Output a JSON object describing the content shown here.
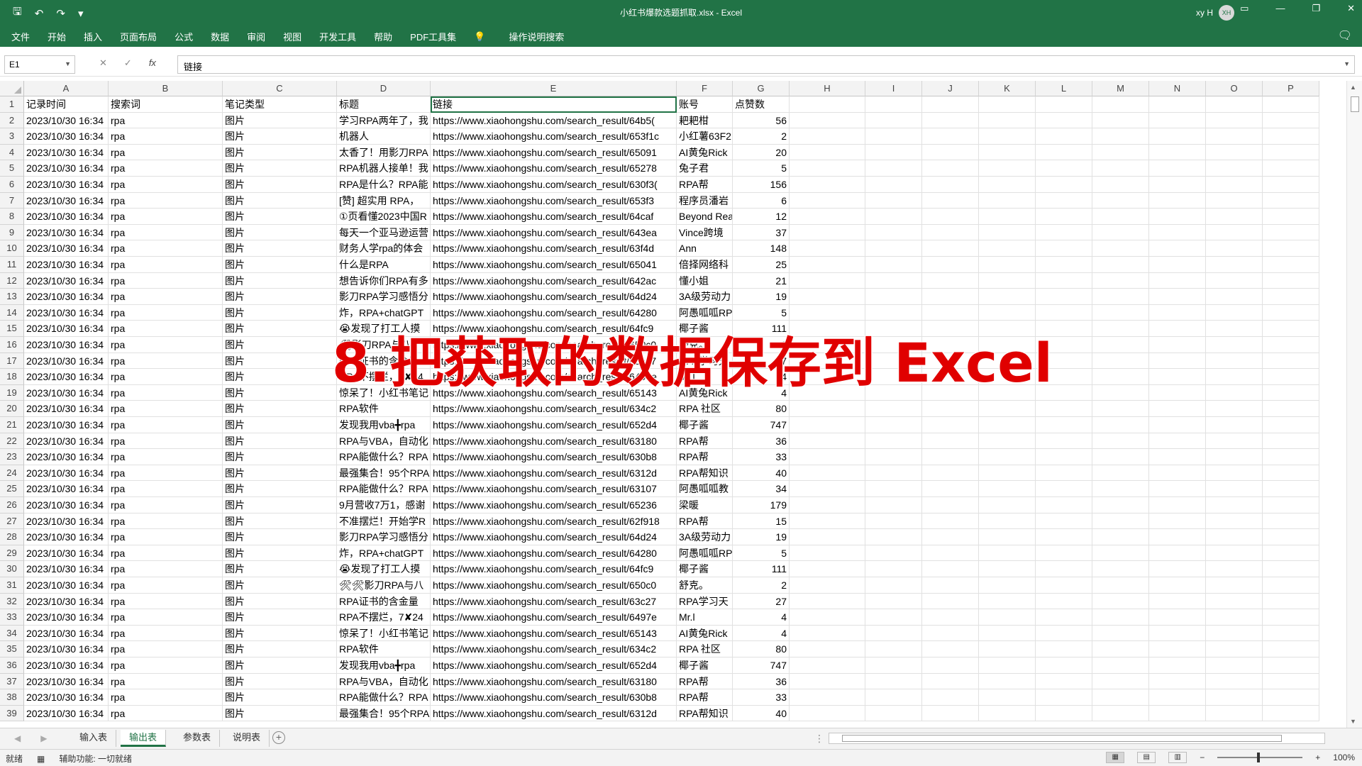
{
  "titlebar": {
    "doc_title": "小红书爆款选题抓取.xlsx  -  Excel",
    "user_name": "xy H",
    "avatar_initials": "XH"
  },
  "menu": [
    "文件",
    "开始",
    "插入",
    "页面布局",
    "公式",
    "数据",
    "审阅",
    "视图",
    "开发工具",
    "帮助",
    "PDF工具集"
  ],
  "tell_me": "操作说明搜索",
  "formula": {
    "name_box": "E1",
    "content": "链接"
  },
  "columns": [
    "A",
    "B",
    "C",
    "D",
    "E",
    "F",
    "G",
    "H",
    "I",
    "J",
    "K",
    "L",
    "M",
    "N",
    "O",
    "P"
  ],
  "header_row": [
    "记录时间",
    "搜索词",
    "笔记类型",
    "标题",
    "链接",
    "账号",
    "点赞数"
  ],
  "rows": [
    [
      "2023/10/30 16:34",
      "rpa",
      "图片",
      "学习RPA两年了，我",
      "https://www.xiaohongshu.com/search_result/64b5(",
      "耙耙柑",
      "56"
    ],
    [
      "2023/10/30 16:34",
      "rpa",
      "图片",
      "机器人",
      "https://www.xiaohongshu.com/search_result/653f1c",
      "小红薯63F2",
      "2"
    ],
    [
      "2023/10/30 16:34",
      "rpa",
      "图片",
      "太香了！用影刀RPA",
      "https://www.xiaohongshu.com/search_result/65091",
      "AI黄兔Rick",
      "20"
    ],
    [
      "2023/10/30 16:34",
      "rpa",
      "图片",
      "RPA机器人接单！我",
      "https://www.xiaohongshu.com/search_result/65278",
      "兔子君",
      "5"
    ],
    [
      "2023/10/30 16:34",
      "rpa",
      "图片",
      "RPA是什么？RPA能",
      "https://www.xiaohongshu.com/search_result/630f3(",
      "RPA帮",
      "156"
    ],
    [
      "2023/10/30 16:34",
      "rpa",
      "图片",
      "[赞] 超实用 RPA，",
      "https://www.xiaohongshu.com/search_result/653f3",
      "程序员潘岩",
      "6"
    ],
    [
      "2023/10/30 16:34",
      "rpa",
      "图片",
      "①页看懂2023中国R",
      "https://www.xiaohongshu.com/search_result/64caf",
      "Beyond Rea",
      "12"
    ],
    [
      "2023/10/30 16:34",
      "rpa",
      "图片",
      "每天一个亚马逊运营",
      "https://www.xiaohongshu.com/search_result/643ea",
      "Vince跨境",
      "37"
    ],
    [
      "2023/10/30 16:34",
      "rpa",
      "图片",
      "财务人学rpa的体会",
      "https://www.xiaohongshu.com/search_result/63f4d",
      "Ann",
      "148"
    ],
    [
      "2023/10/30 16:34",
      "rpa",
      "图片",
      "什么是RPA",
      "https://www.xiaohongshu.com/search_result/65041",
      "倍择网络科",
      "25"
    ],
    [
      "2023/10/30 16:34",
      "rpa",
      "图片",
      "想告诉你们RPA有多",
      "https://www.xiaohongshu.com/search_result/642ac",
      "懂小姐",
      "21"
    ],
    [
      "2023/10/30 16:34",
      "rpa",
      "图片",
      "影刀RPA学习感悟分",
      "https://www.xiaohongshu.com/search_result/64d24",
      "3A级劳动力",
      "19"
    ],
    [
      "2023/10/30 16:34",
      "rpa",
      "图片",
      "炸，RPA+chatGPT",
      "https://www.xiaohongshu.com/search_result/64280",
      "阿愚呱呱RP",
      "5"
    ],
    [
      "2023/10/30 16:34",
      "rpa",
      "图片",
      "😭发现了打工人摸",
      "https://www.xiaohongshu.com/search_result/64fc9",
      "椰子酱",
      "111"
    ],
    [
      "2023/10/30 16:34",
      "rpa",
      "图片",
      "🛠影刀RPA与八",
      "https://www.xiaohongshu.com/search_result/650c0",
      "舒克。",
      "2"
    ],
    [
      "2023/10/30 16:34",
      "rpa",
      "图片",
      "RPA证书的含金量",
      "https://www.xiaohongshu.com/search_result/63c27",
      "RPA学习天",
      "27"
    ],
    [
      "2023/10/30 16:34",
      "rpa",
      "图片",
      "RPA不摆烂，7✘24",
      "https://www.xiaohongshu.com/search_result/6497e",
      "Mr.l",
      "4"
    ],
    [
      "2023/10/30 16:34",
      "rpa",
      "图片",
      "惊呆了！小红书笔记",
      "https://www.xiaohongshu.com/search_result/65143",
      "AI黄兔Rick",
      "4"
    ],
    [
      "2023/10/30 16:34",
      "rpa",
      "图片",
      "RPA软件",
      "https://www.xiaohongshu.com/search_result/634c2",
      "RPA 社区",
      "80"
    ],
    [
      "2023/10/30 16:34",
      "rpa",
      "图片",
      "发现我用vba╋rpa",
      "https://www.xiaohongshu.com/search_result/652d4",
      "椰子酱",
      "747"
    ],
    [
      "2023/10/30 16:34",
      "rpa",
      "图片",
      "RPA与VBA，自动化",
      "https://www.xiaohongshu.com/search_result/63180",
      "RPA帮",
      "36"
    ],
    [
      "2023/10/30 16:34",
      "rpa",
      "图片",
      "RPA能做什么？RPA",
      "https://www.xiaohongshu.com/search_result/630b8",
      "RPA帮",
      "33"
    ],
    [
      "2023/10/30 16:34",
      "rpa",
      "图片",
      "最强集合！95个RPA",
      "https://www.xiaohongshu.com/search_result/6312d",
      "RPA帮知识",
      "40"
    ],
    [
      "2023/10/30 16:34",
      "rpa",
      "图片",
      "RPA能做什么？RPA",
      "https://www.xiaohongshu.com/search_result/63107",
      "阿愚呱呱教",
      "34"
    ],
    [
      "2023/10/30 16:34",
      "rpa",
      "图片",
      "9月营收7万1，感谢",
      "https://www.xiaohongshu.com/search_result/65236",
      "梁暖",
      "179"
    ],
    [
      "2023/10/30 16:34",
      "rpa",
      "图片",
      "不准摆烂！开始学R",
      "https://www.xiaohongshu.com/search_result/62f918",
      "RPA帮",
      "15"
    ],
    [
      "2023/10/30 16:34",
      "rpa",
      "图片",
      "影刀RPA学习感悟分",
      "https://www.xiaohongshu.com/search_result/64d24",
      "3A级劳动力",
      "19"
    ],
    [
      "2023/10/30 16:34",
      "rpa",
      "图片",
      "炸，RPA+chatGPT",
      "https://www.xiaohongshu.com/search_result/64280",
      "阿愚呱呱RP",
      "5"
    ],
    [
      "2023/10/30 16:34",
      "rpa",
      "图片",
      "😭发现了打工人摸",
      "https://www.xiaohongshu.com/search_result/64fc9",
      "椰子酱",
      "111"
    ],
    [
      "2023/10/30 16:34",
      "rpa",
      "图片",
      "🛠🛠影刀RPA与八",
      "https://www.xiaohongshu.com/search_result/650c0",
      "舒克。",
      "2"
    ],
    [
      "2023/10/30 16:34",
      "rpa",
      "图片",
      "RPA证书的含金量",
      "https://www.xiaohongshu.com/search_result/63c27",
      "RPA学习天",
      "27"
    ],
    [
      "2023/10/30 16:34",
      "rpa",
      "图片",
      "RPA不摆烂，7✘24",
      "https://www.xiaohongshu.com/search_result/6497e",
      "Mr.l",
      "4"
    ],
    [
      "2023/10/30 16:34",
      "rpa",
      "图片",
      "惊呆了！小红书笔记",
      "https://www.xiaohongshu.com/search_result/65143",
      "AI黄兔Rick",
      "4"
    ],
    [
      "2023/10/30 16:34",
      "rpa",
      "图片",
      "RPA软件",
      "https://www.xiaohongshu.com/search_result/634c2",
      "RPA 社区",
      "80"
    ],
    [
      "2023/10/30 16:34",
      "rpa",
      "图片",
      "发现我用vba╋rpa",
      "https://www.xiaohongshu.com/search_result/652d4",
      "椰子酱",
      "747"
    ],
    [
      "2023/10/30 16:34",
      "rpa",
      "图片",
      "RPA与VBA，自动化",
      "https://www.xiaohongshu.com/search_result/63180",
      "RPA帮",
      "36"
    ],
    [
      "2023/10/30 16:34",
      "rpa",
      "图片",
      "RPA能做什么？RPA",
      "https://www.xiaohongshu.com/search_result/630b8",
      "RPA帮",
      "33"
    ],
    [
      "2023/10/30 16:34",
      "rpa",
      "图片",
      "最强集合！95个RPA",
      "https://www.xiaohongshu.com/search_result/6312d",
      "RPA帮知识",
      "40"
    ]
  ],
  "sheets": [
    {
      "name": "输入表",
      "active": false
    },
    {
      "name": "输出表",
      "active": true
    },
    {
      "name": "参数表",
      "active": false
    },
    {
      "name": "说明表",
      "active": false
    }
  ],
  "status": {
    "ready": "就绪",
    "accessibility": "辅助功能: 一切就绪",
    "zoom": "100%"
  },
  "overlay_title": "8.把获取的数据保存到 Excel"
}
